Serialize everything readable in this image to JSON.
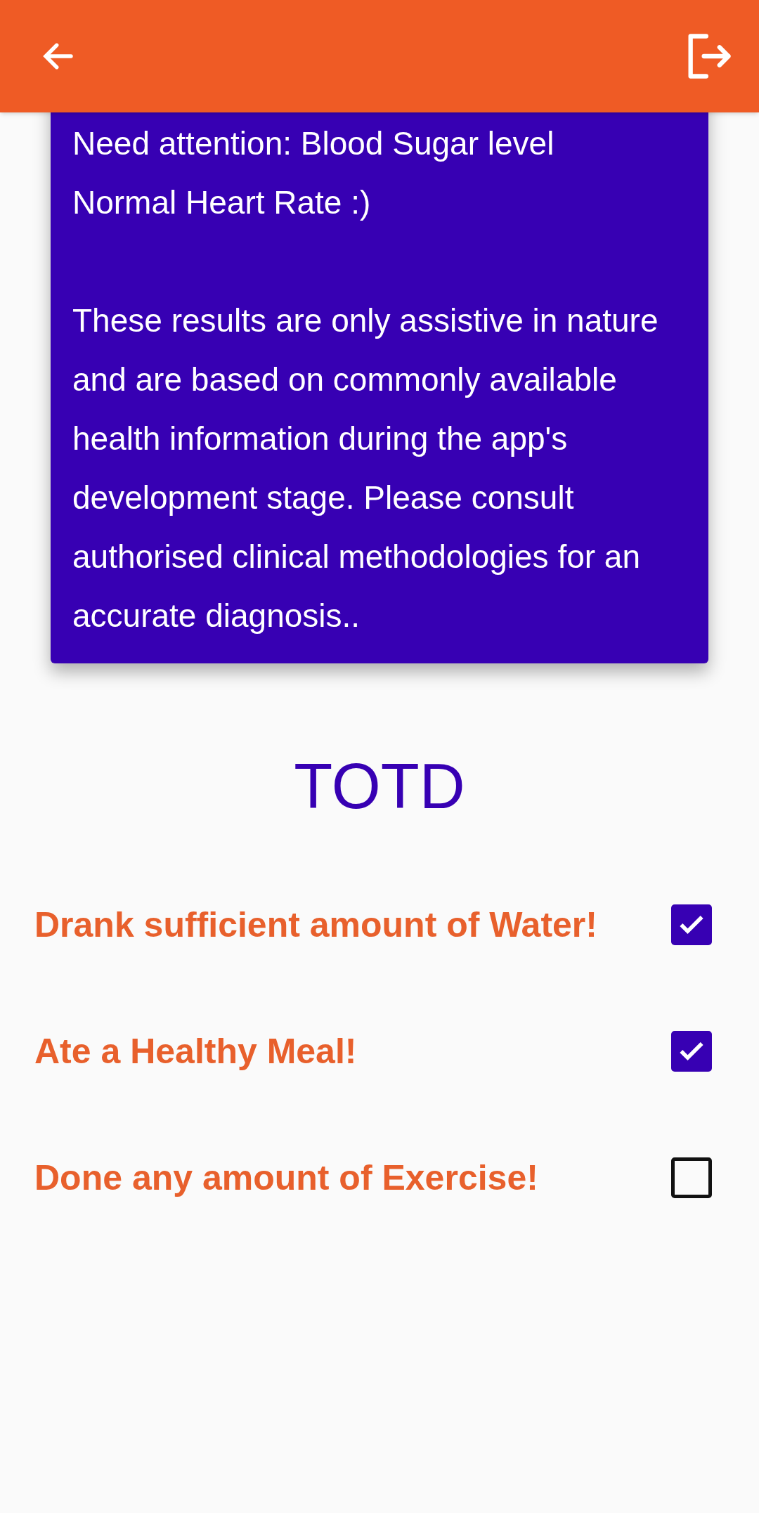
{
  "card": {
    "status_lines": [
      "Need attention: Blood Sugar level",
      "Normal Heart Rate :)"
    ],
    "disclaimer": "These results are only assistive in nature and are based on commonly available health information during the app's development stage. Please consult authorised clinical methodologies for an accurate diagnosis.."
  },
  "totd": {
    "title": "TOTD",
    "items": [
      {
        "label": "Drank sufficient amount of Water!",
        "checked": true
      },
      {
        "label": "Ate a Healthy Meal!",
        "checked": true
      },
      {
        "label": "Done any amount of Exercise!",
        "checked": false
      }
    ]
  }
}
